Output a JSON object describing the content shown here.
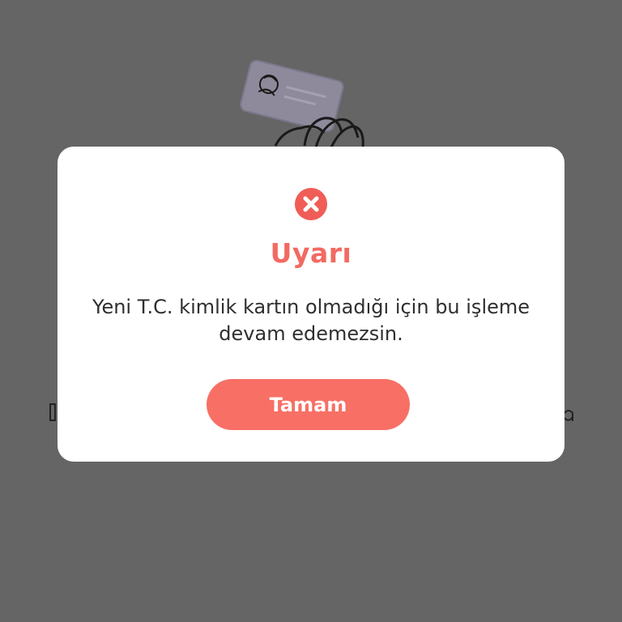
{
  "dialog": {
    "icon": "error-x-icon",
    "title": "Uyarı",
    "message": "Yeni T.C. kimlik kartın olmadığı için bu işleme devam edemezsin.",
    "ok_label": "Tamam"
  },
  "background": {
    "illustration": "id-card-hand-illustration"
  },
  "colors": {
    "overlay": "#656565",
    "accent": "#f26a62",
    "button": "#f86f65",
    "dialog_bg": "#ffffff",
    "text": "#2f2f2f"
  }
}
